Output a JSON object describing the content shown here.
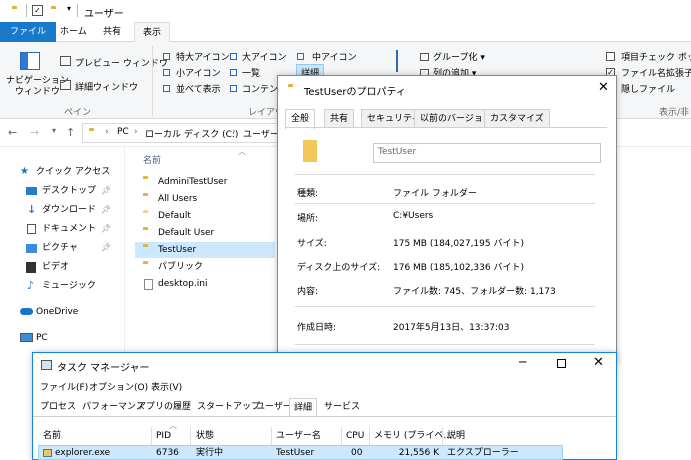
{
  "explorer": {
    "title": "ユーザー",
    "menu_tabs": [
      "ファイル",
      "ホーム",
      "共有",
      "表示"
    ],
    "ribbon": {
      "panes_group": "ペイン",
      "nav_pane": "ナビゲーション\nウィンドウ",
      "preview_pane": "プレビュー ウィンドウ",
      "details_pane": "詳細ウィンドウ",
      "layout_group": "レイアウ",
      "layout_items": [
        "特大アイコン",
        "大アイコン",
        "中アイコン",
        "小アイコン",
        "一覧",
        "詳細",
        "並べて表示",
        "コンテンツ"
      ],
      "group_by": "グループ化 ▾",
      "add_column": "列の追加 ▾",
      "item_checkbox": "項目チェック ボック",
      "file_ext": "ファイル名拡張子",
      "hidden_files": "隠しファイル",
      "show_hide_group": "表示/非"
    },
    "address": [
      "PC",
      "ローカル ディスク (C:)",
      "ユーザー"
    ],
    "nav": {
      "quick_access": "クイック アクセス",
      "items": [
        "デスクトップ",
        "ダウンロード",
        "ドキュメント",
        "ピクチャ",
        "ビデオ",
        "ミュージック"
      ],
      "onedrive": "OneDrive",
      "pc": "PC"
    },
    "column_name": "名前",
    "files": [
      "AdminiTestUser",
      "All Users",
      "Default",
      "Default User",
      "TestUser",
      "パブリック",
      "desktop.ini"
    ]
  },
  "properties": {
    "title": "TestUserのプロパティ",
    "tabs": [
      "全般",
      "共有",
      "セキュリティ",
      "以前のバージョン",
      "カスタマイズ"
    ],
    "name_value": "TestUser",
    "rows": [
      {
        "label": "種類:",
        "value": "ファイル フォルダー"
      },
      {
        "label": "場所:",
        "value": "C:¥Users"
      },
      {
        "label": "サイズ:",
        "value": "175 MB (184,027,195 バイト)"
      },
      {
        "label": "ディスク上のサイズ:",
        "value": "176 MB (185,102,336 バイト)"
      },
      {
        "label": "内容:",
        "value": "ファイル数: 745、フォルダー数: 1,173"
      },
      {
        "label": "作成日時:",
        "value": "2017年5月13日、13:37:03"
      }
    ]
  },
  "taskmgr": {
    "title": "タスク マネージャー",
    "menu": [
      "ファイル(F)",
      "オプション(O)",
      "表示(V)"
    ],
    "tabs": [
      "プロセス",
      "パフォーマンス",
      "アプリの履歴",
      "スタートアップ",
      "ユーザー",
      "詳細",
      "サービス"
    ],
    "columns": [
      "名前",
      "PID",
      "状態",
      "ユーザー名",
      "CPU",
      "メモリ (プライベ...",
      "説明"
    ],
    "row": {
      "name": "explorer.exe",
      "pid": "6736",
      "status": "実行中",
      "user": "TestUser",
      "cpu": "00",
      "memory": "21,556 K",
      "desc": "エクスプローラー"
    }
  }
}
